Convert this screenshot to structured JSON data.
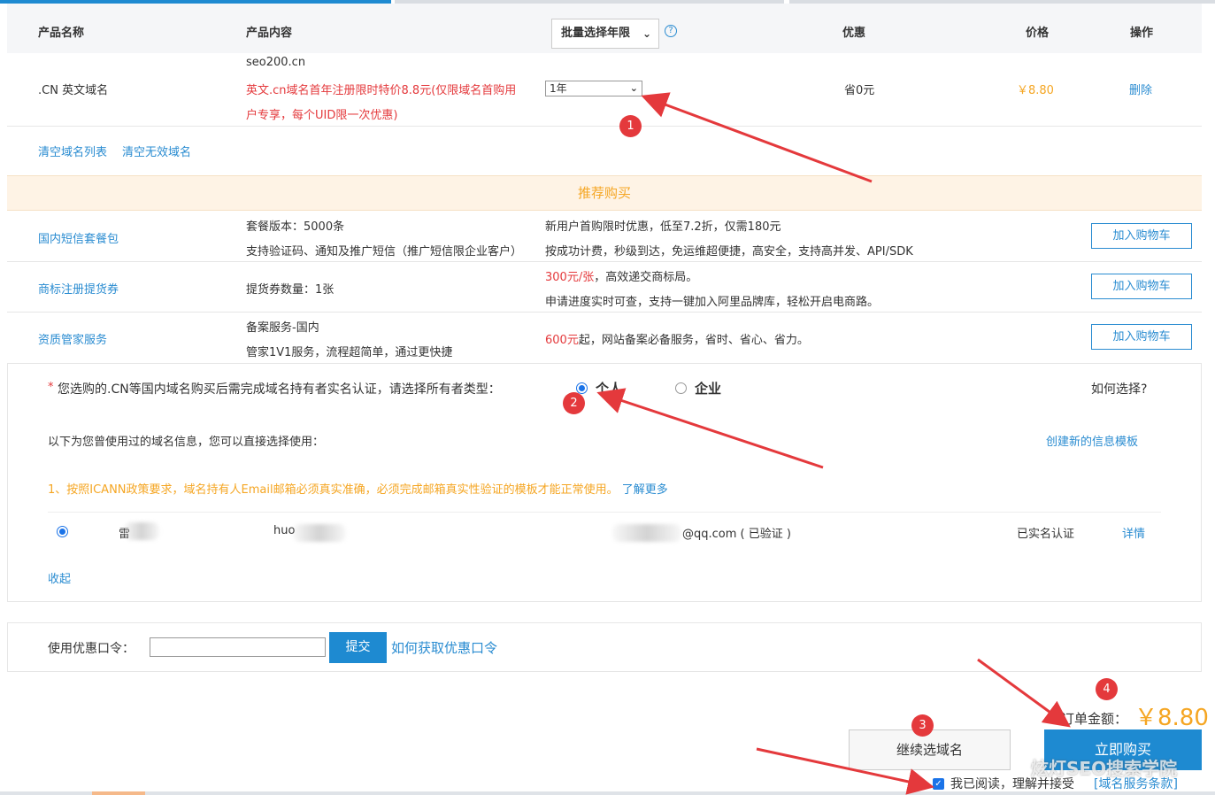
{
  "table": {
    "headers": {
      "name": "产品名称",
      "content": "产品内容",
      "batch_period": "批量选择年限",
      "discount": "优惠",
      "price": "价格",
      "action": "操作"
    },
    "item": {
      "name": ".CN 英文域名",
      "domain": "seo200.cn",
      "promo_line1": "英文.cn域名首年注册限时特价8.8元(仅限域名首购用",
      "promo_line2": "户专享，每个UID限一次优惠)",
      "period": "1年",
      "discount": "省0元",
      "price": "￥8.80",
      "delete": "删除"
    }
  },
  "list_links": {
    "clear_list": "清空域名列表",
    "clear_invalid": "清空无效域名"
  },
  "recommend": {
    "title": "推荐购买",
    "items": [
      {
        "name": "国内短信套餐包",
        "content1": "套餐版本：5000条",
        "content2": "支持验证码、通知及推广短信（推广短信限企业客户）",
        "desc1_red": "",
        "desc1": "新用户首购限时优惠，低至7.2折，仅需180元",
        "desc2": "按成功计费，秒级到达，免运维超便捷，高安全，支持高并发、API/SDK",
        "button": "加入购物车"
      },
      {
        "name": "商标注册提货券",
        "content1": "提货券数量：1张",
        "content2": "",
        "desc1_red": "300元/张",
        "desc1": "，高效递交商标局。",
        "desc2": "申请进度实时可查，支持一键加入阿里品牌库，轻松开启电商路。",
        "button": "加入购物车"
      },
      {
        "name": "资质管家服务",
        "content1": "备案服务-国内",
        "content2": "管家1V1服务，流程超简单，通过更快捷",
        "desc1_red": "600元",
        "desc1": "起，网站备案必备服务，省时、省心、省力。",
        "desc2": "",
        "button": "加入购物车"
      }
    ]
  },
  "owner": {
    "asterisk": "*",
    "prompt": "您选购的.CN等国内域名购买后需完成域名持有者实名认证，请选择所有者类型：",
    "type_personal": "个人",
    "type_company": "企业",
    "how_choose": "如何选择?",
    "history_label": "以下为您曾使用过的域名信息，您可以直接选择使用：",
    "create_template": "创建新的信息模板",
    "notice": "1、按照ICANN政策要求，域名持有人Email邮箱必须真实准确，必须完成邮箱真实性验证的模板才能正常使用。",
    "learn_more": "了解更多",
    "record": {
      "name": "雷",
      "pinyin": "huo",
      "email": "@qq.com ( 已验证 )",
      "status": "已实名认证",
      "detail": "详情"
    },
    "collapse": "收起"
  },
  "coupon": {
    "label": "使用优惠口令：",
    "value": "",
    "submit": "提交",
    "how_to_get": "如何获取优惠口令"
  },
  "order": {
    "amount_label": "订单金额：",
    "amount": "￥8.80",
    "continue": "继续选域名",
    "buy_now": "立即购买",
    "agree_prefix": "我已阅读，理解并接受",
    "terms_link": "[域名服务条款]"
  },
  "markers": [
    "1",
    "2",
    "3",
    "4"
  ],
  "watermark": "炫灯SEO搜索学院",
  "colors": {
    "accent_blue": "#1e8ad1",
    "price_orange": "#f5a623",
    "promo_red": "#e4393c",
    "annotation_red": "#e4393c"
  }
}
